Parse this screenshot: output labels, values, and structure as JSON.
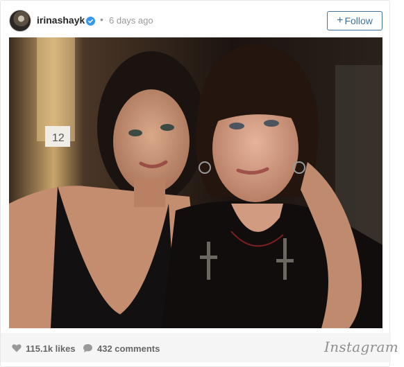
{
  "post": {
    "username": "irinashayk",
    "verified": true,
    "separator": "•",
    "posted_time": "6 days ago",
    "follow_label": "Follow",
    "follow_plus": "+",
    "photo": {
      "description_icon": "photo-of-two-women"
    },
    "likes": "115.1k likes",
    "comments": "432 comments",
    "brand": "Instagram"
  },
  "colors": {
    "follow_accent": "#3f729b",
    "verified_badge": "#3897f0",
    "muted_text": "#999999",
    "footer_bg": "#f5f5f5"
  }
}
